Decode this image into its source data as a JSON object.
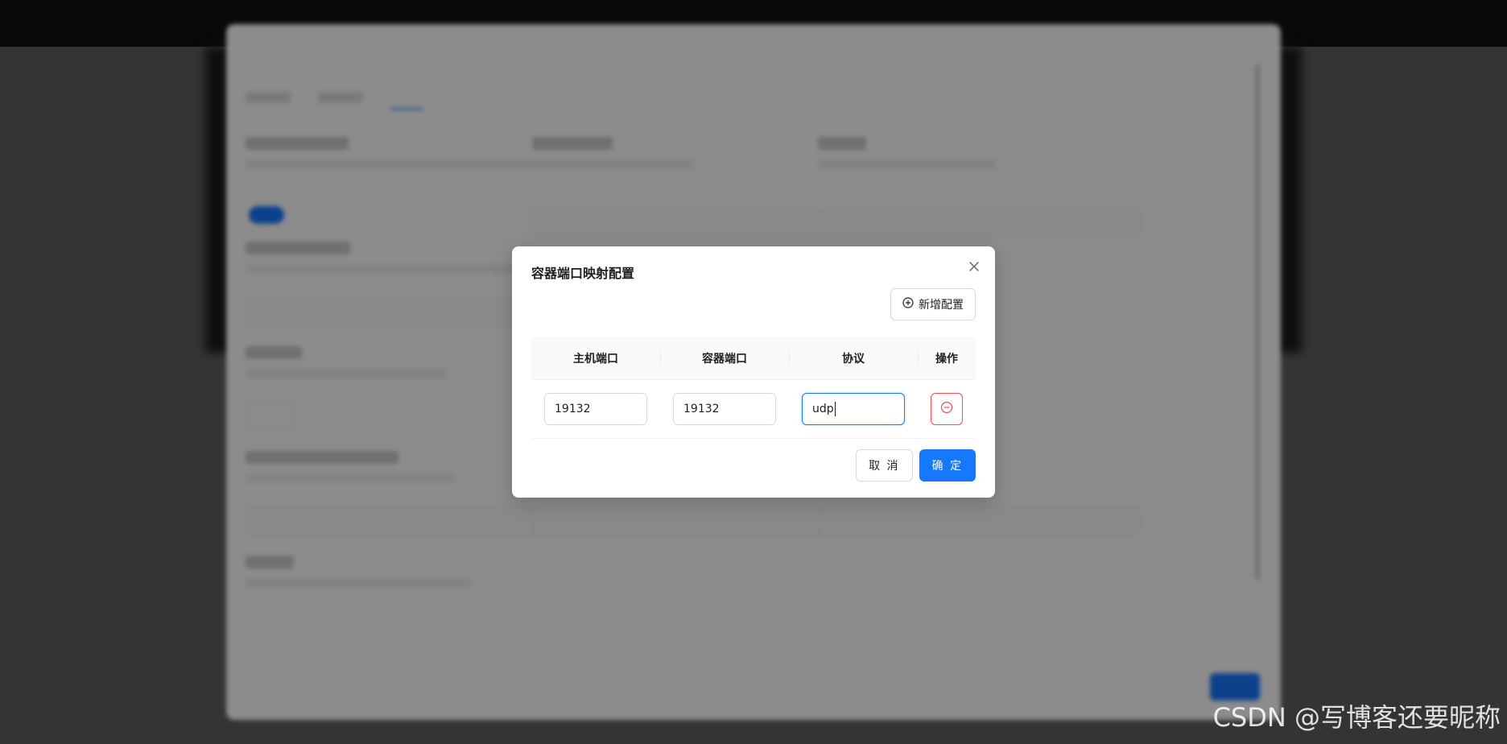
{
  "modal": {
    "title": "容器端口映射配置",
    "add_button_label": "新增配置",
    "columns": [
      "主机端口",
      "容器端口",
      "协议",
      "操作"
    ],
    "rows": [
      {
        "host_port": "19132",
        "container_port": "19132",
        "protocol": "udp"
      }
    ],
    "cancel_label": "取 消",
    "ok_label": "确 定"
  },
  "watermark": "CSDN @写博客还要昵称",
  "colors": {
    "primary": "#1677ff",
    "danger": "#ff4d4f",
    "border": "#d9d9d9",
    "header_bg": "#fafafa"
  },
  "icons": {
    "close": "close-icon",
    "add": "plus-circle-icon",
    "delete": "minus-circle-icon"
  }
}
